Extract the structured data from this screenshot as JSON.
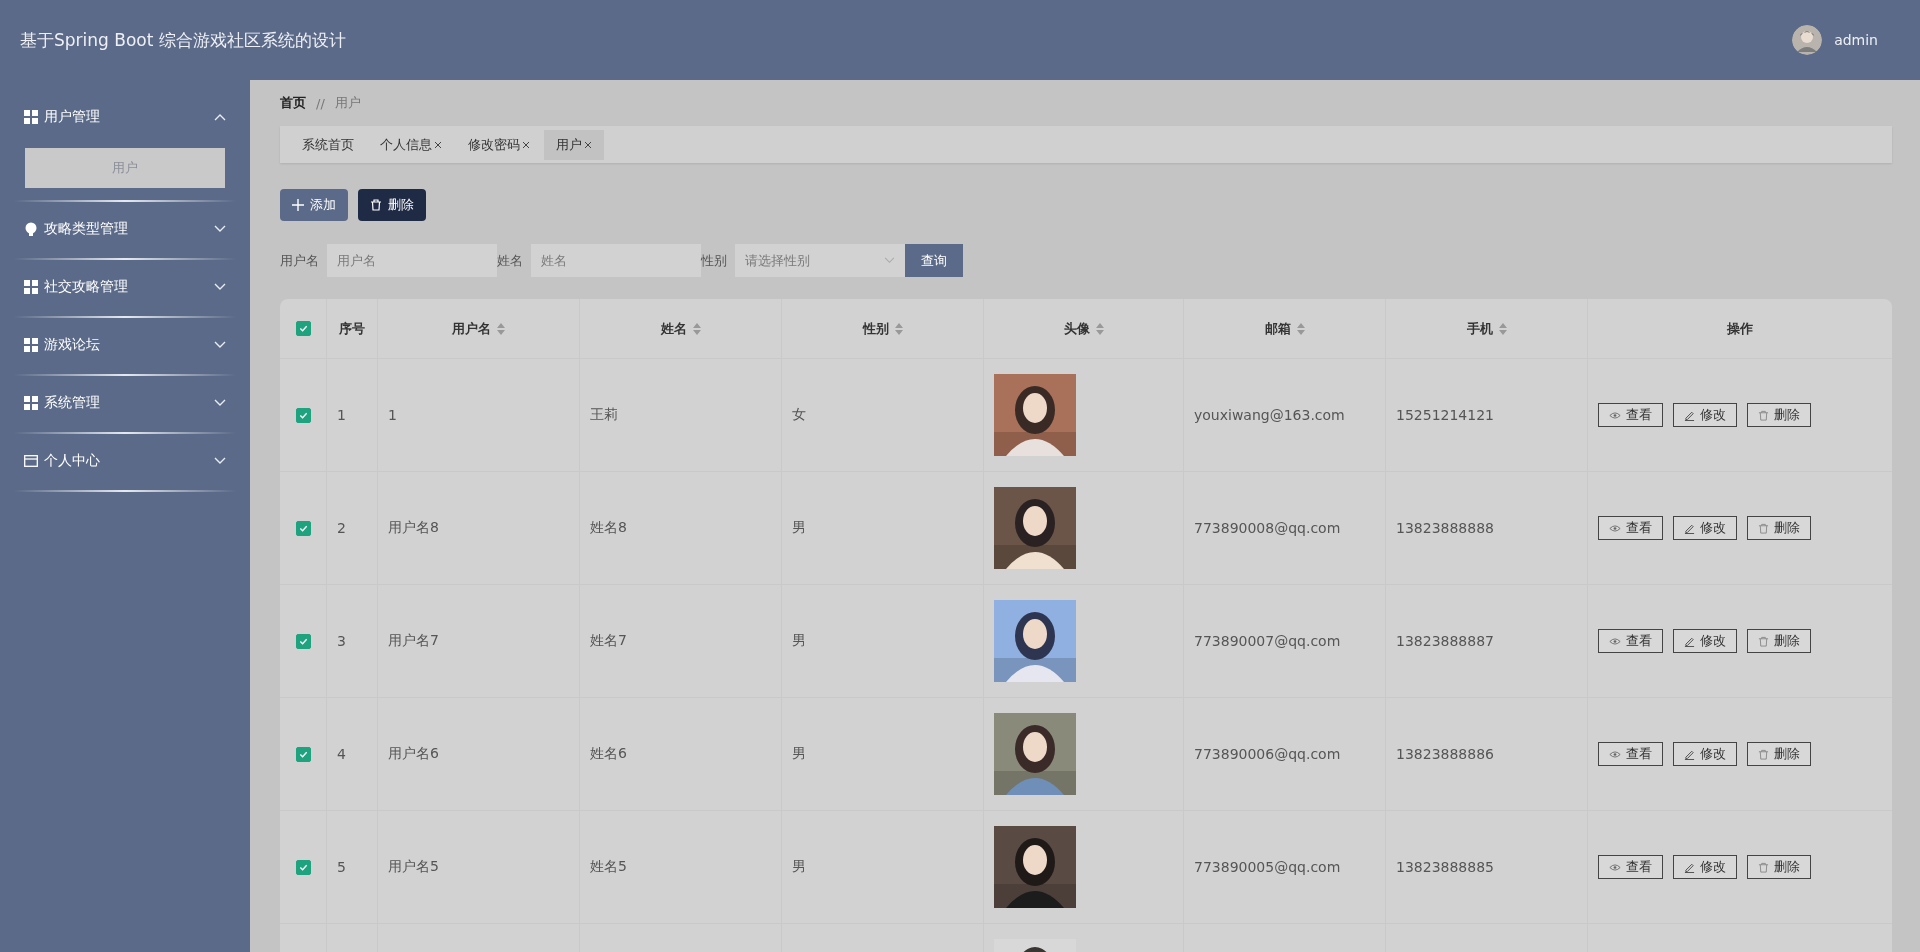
{
  "header": {
    "title": "基于Spring Boot 综合游戏社区系统的设计",
    "user": "admin"
  },
  "sidebar": {
    "items": [
      {
        "label": "用户管理",
        "kind": "grid",
        "expanded": true,
        "children": [
          {
            "label": "用户",
            "selected": true
          }
        ]
      },
      {
        "label": "攻略类型管理",
        "kind": "bulb",
        "expanded": false
      },
      {
        "label": "社交攻略管理",
        "kind": "grid",
        "expanded": false
      },
      {
        "label": "游戏论坛",
        "kind": "grid",
        "expanded": false
      },
      {
        "label": "系统管理",
        "kind": "grid",
        "expanded": false
      },
      {
        "label": "个人中心",
        "kind": "card",
        "expanded": false
      }
    ]
  },
  "breadcrumb": [
    "首页",
    "//",
    "用户"
  ],
  "tabs": [
    {
      "label": "系统首页",
      "closable": false,
      "selected": false
    },
    {
      "label": "个人信息",
      "closable": true,
      "selected": false
    },
    {
      "label": "修改密码",
      "closable": true,
      "selected": false
    },
    {
      "label": "用户",
      "closable": true,
      "selected": true
    }
  ],
  "actions": [
    {
      "label": "添加",
      "kind": "add"
    },
    {
      "label": "删除",
      "kind": "delete"
    }
  ],
  "filters": [
    {
      "label": "用户名",
      "placeholder": "用户名",
      "kind": "text"
    },
    {
      "label": "姓名",
      "placeholder": "姓名",
      "kind": "text"
    },
    {
      "label": "性别",
      "placeholder": "请选择性别",
      "kind": "select"
    }
  ],
  "search_button": "查询",
  "table": {
    "all_checked": true,
    "columns": [
      {
        "label": "序号",
        "sortable": false
      },
      {
        "label": "用户名",
        "sortable": true
      },
      {
        "label": "姓名",
        "sortable": true
      },
      {
        "label": "性别",
        "sortable": true
      },
      {
        "label": "头像",
        "sortable": true
      },
      {
        "label": "邮箱",
        "sortable": true
      },
      {
        "label": "手机",
        "sortable": true
      },
      {
        "label": "操作",
        "sortable": false
      }
    ],
    "rows": [
      {
        "checked": true,
        "index": "1",
        "username": "1",
        "name": "王莉",
        "gender": "女",
        "email": "youxiwang@163.com",
        "phone": "15251214121",
        "actions": [
          {
            "label": "查看",
            "kind": "view"
          },
          {
            "label": "修改",
            "kind": "edit"
          },
          {
            "label": "删除",
            "kind": "delete"
          }
        ]
      },
      {
        "checked": true,
        "index": "2",
        "username": "用户名8",
        "name": "姓名8",
        "gender": "男",
        "email": "773890008@qq.com",
        "phone": "13823888888",
        "actions": [
          {
            "label": "查看",
            "kind": "view"
          },
          {
            "label": "修改",
            "kind": "edit"
          },
          {
            "label": "删除",
            "kind": "delete"
          }
        ]
      },
      {
        "checked": true,
        "index": "3",
        "username": "用户名7",
        "name": "姓名7",
        "gender": "男",
        "email": "773890007@qq.com",
        "phone": "13823888887",
        "actions": [
          {
            "label": "查看",
            "kind": "view"
          },
          {
            "label": "修改",
            "kind": "edit"
          },
          {
            "label": "删除",
            "kind": "delete"
          }
        ]
      },
      {
        "checked": true,
        "index": "4",
        "username": "用户名6",
        "name": "姓名6",
        "gender": "男",
        "email": "773890006@qq.com",
        "phone": "13823888886",
        "actions": [
          {
            "label": "查看",
            "kind": "view"
          },
          {
            "label": "修改",
            "kind": "edit"
          },
          {
            "label": "删除",
            "kind": "delete"
          }
        ]
      },
      {
        "checked": true,
        "index": "5",
        "username": "用户名5",
        "name": "姓名5",
        "gender": "男",
        "email": "773890005@qq.com",
        "phone": "13823888885",
        "actions": [
          {
            "label": "查看",
            "kind": "view"
          },
          {
            "label": "修改",
            "kind": "edit"
          },
          {
            "label": "删除",
            "kind": "delete"
          }
        ]
      }
    ]
  }
}
